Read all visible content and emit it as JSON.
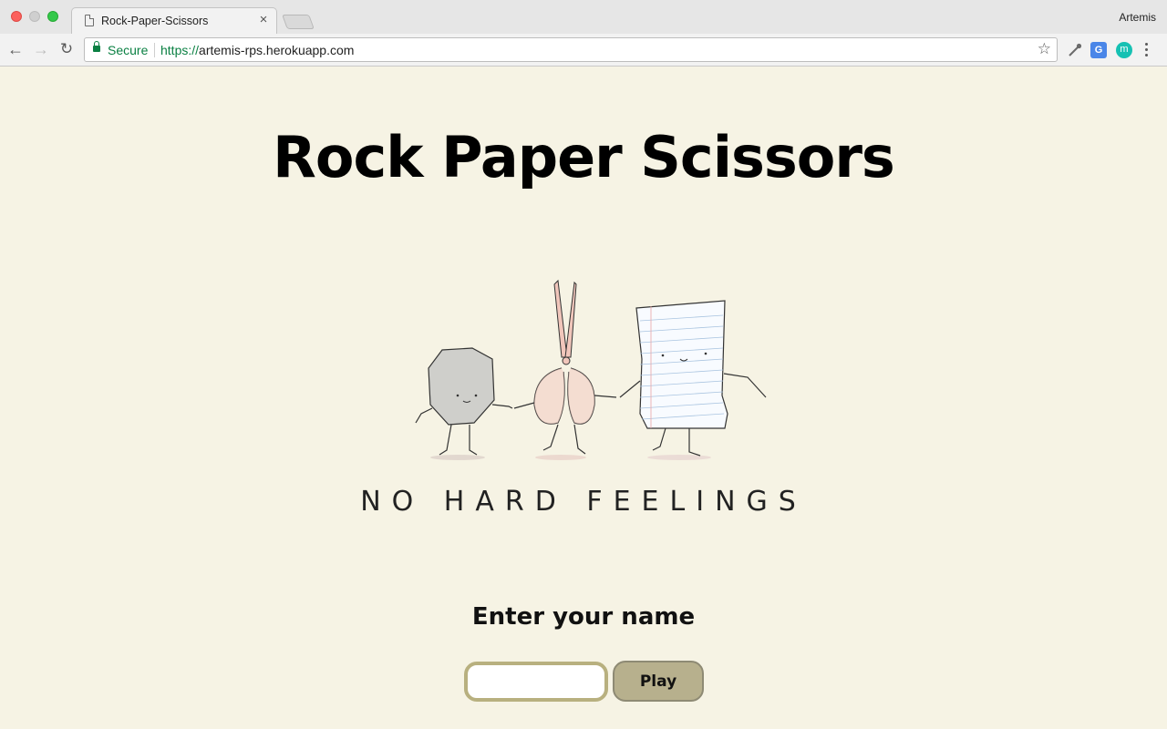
{
  "browser": {
    "tab_title": "Rock-Paper-Scissors",
    "tab_close": "×",
    "profile_name": "Artemis",
    "security_label": "Secure",
    "url_scheme": "https://",
    "url_host": "artemis-rps.herokuapp.com",
    "translate_icon": "G",
    "extension_m": "m"
  },
  "page": {
    "title": "Rock Paper Scissors",
    "illustration_caption": "NO HARD FEELINGS",
    "prompt": "Enter your name",
    "name_input_value": "",
    "play_label": "Play"
  },
  "colors": {
    "background": "#f6f3e4",
    "input_border": "#b8b07f",
    "button_fill": "#b7b08d",
    "secure_green": "#0b8043"
  }
}
